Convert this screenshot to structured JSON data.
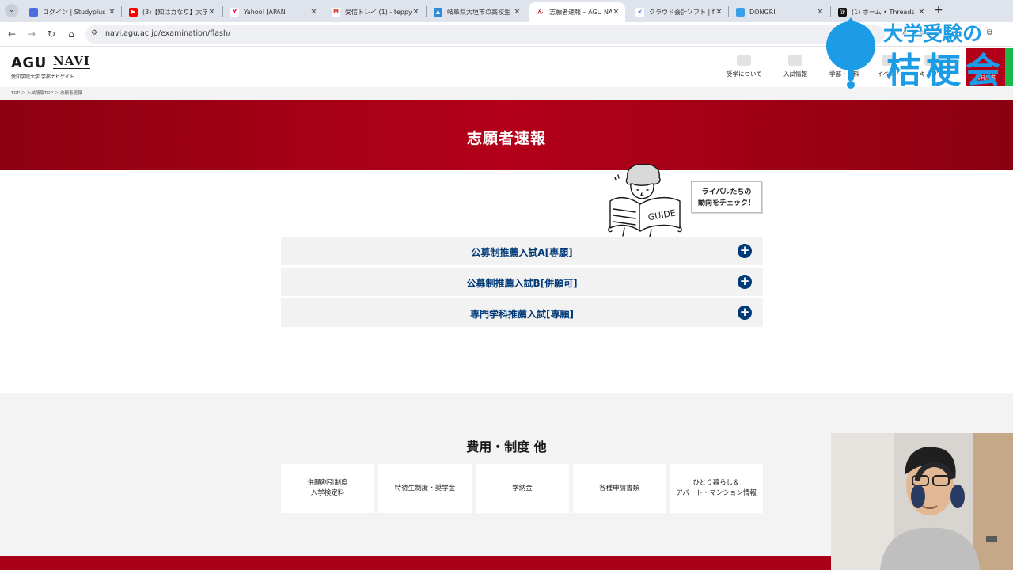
{
  "browser": {
    "tabs": [
      {
        "title": "ログイン | Studyplus for",
        "icon_color": "#4a6ee0"
      },
      {
        "title": "(3)【知はカなり】大学",
        "icon_color": "#ff0000"
      },
      {
        "title": "Yahoo! JAPAN",
        "icon_color": "#ff0033"
      },
      {
        "title": "受信トレイ (1) - teppy",
        "icon_color": "#d93025"
      },
      {
        "title": "岐阜県大垣市の高校生",
        "icon_color": "#2e8bd6"
      },
      {
        "title": "志願者速報 – AGU NAVI",
        "icon_color": "#c4001a"
      },
      {
        "title": "クラウド会計ソフト | fre",
        "icon_color": "#2864f0"
      },
      {
        "title": "DONGRI",
        "icon_color": "#3aa0e8"
      },
      {
        "title": "(1) ホーム • Threads",
        "icon_color": "#111111"
      }
    ],
    "url": "navi.agu.ac.jp/examination/flash/"
  },
  "header": {
    "logo_main": "AGU",
    "logo_navi": "NAVI",
    "logo_sub": "愛知学院大学 学部ナビゲイト",
    "nav": [
      "受学について",
      "入試情報",
      "学部・学科",
      "イベント",
      "キャリア"
    ],
    "request_label": "資料請求"
  },
  "breadcrumb": [
    "TOP",
    "入試情報TOP",
    "志願者速報"
  ],
  "hero": {
    "title": "志願者速報"
  },
  "illustration": {
    "guide_text": "GUIDE"
  },
  "bubble": {
    "line1": "ライバルたちの",
    "line2": "動向をチェック！"
  },
  "accordions": [
    "公募制推薦入試A[専願]",
    "公募制推薦入試B[併願可]",
    "専門学科推薦入試[専願]"
  ],
  "fees": {
    "title": "費用・制度 他",
    "cards": [
      {
        "line1": "併願割引制度",
        "line2": "入学検定料"
      },
      {
        "line1": "特待生制度・奨学金",
        "line2": ""
      },
      {
        "line1": "学納金",
        "line2": ""
      },
      {
        "line1": "各種申請書類",
        "line2": ""
      },
      {
        "line1": "ひとり暮らし＆",
        "line2": "アパート・マンション情報"
      }
    ]
  },
  "overlay": {
    "line1": "大学受験の",
    "line2": "桔梗会"
  },
  "colors": {
    "brand_red": "#b4001a",
    "navy": "#003a78",
    "overlay_blue": "#1c9be6"
  }
}
